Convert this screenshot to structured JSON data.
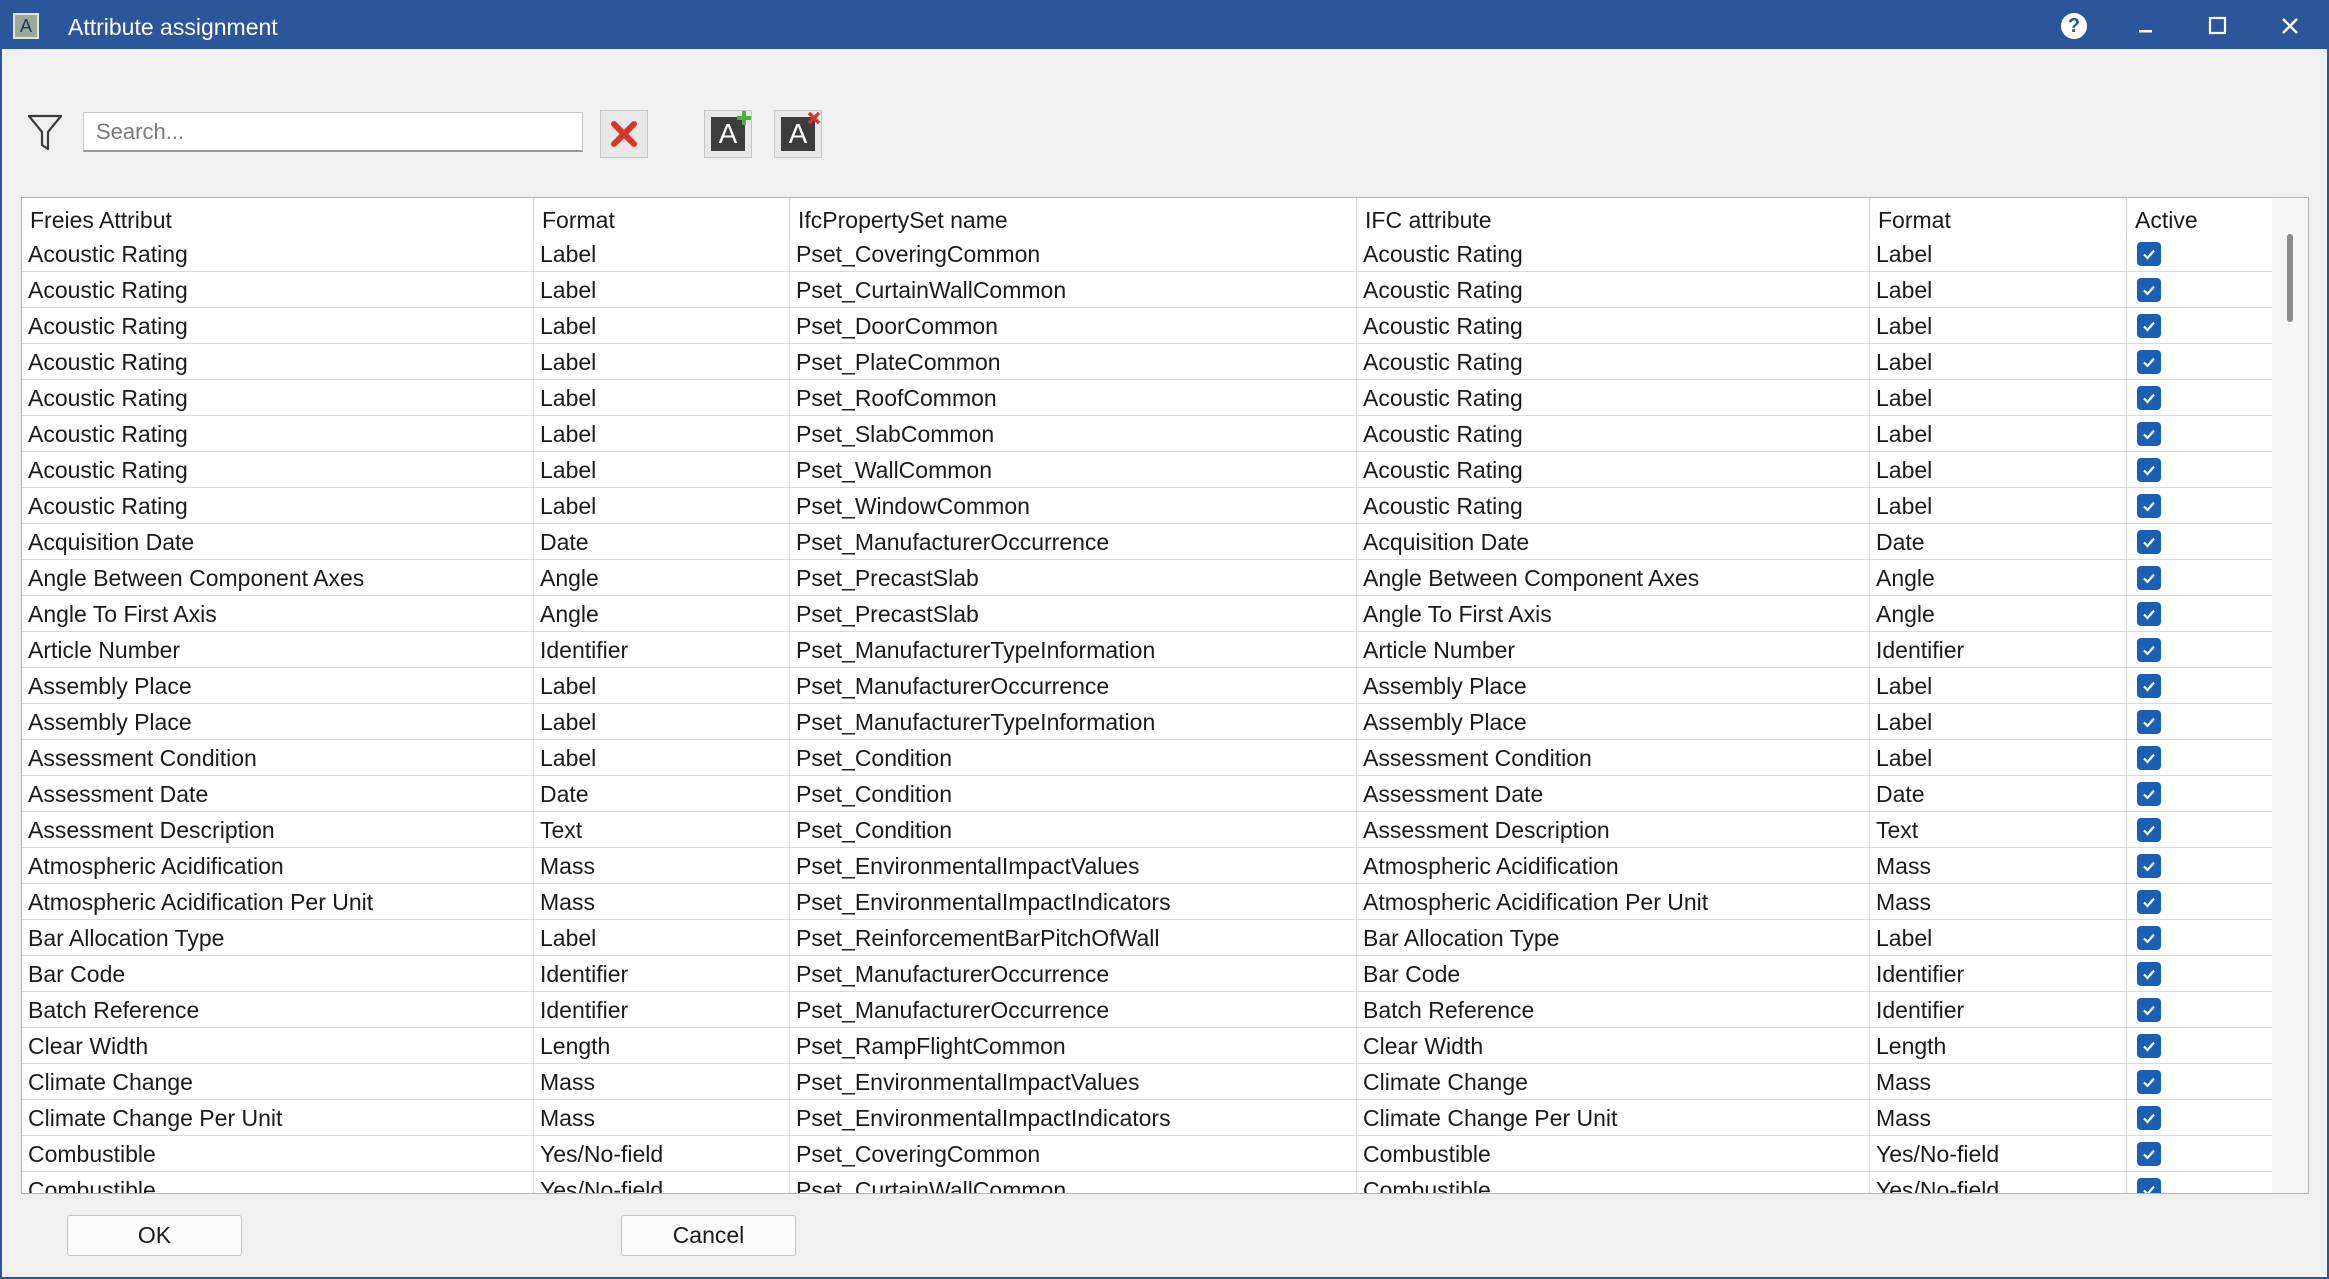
{
  "window": {
    "title": "Attribute assignment",
    "app_icon": "A"
  },
  "toolbar": {
    "search_placeholder": "Search...",
    "search_value": "",
    "add_glyph": "A",
    "delete_glyph": "A"
  },
  "table": {
    "headers": [
      "Freies Attribut",
      "Format",
      "IfcPropertySet name",
      "IFC attribute",
      "Format",
      "Active"
    ],
    "rows": [
      [
        "Acoustic Rating",
        "Label",
        "Pset_CoveringCommon",
        "Acoustic Rating",
        "Label",
        true
      ],
      [
        "Acoustic Rating",
        "Label",
        "Pset_CurtainWallCommon",
        "Acoustic Rating",
        "Label",
        true
      ],
      [
        "Acoustic Rating",
        "Label",
        "Pset_DoorCommon",
        "Acoustic Rating",
        "Label",
        true
      ],
      [
        "Acoustic Rating",
        "Label",
        "Pset_PlateCommon",
        "Acoustic Rating",
        "Label",
        true
      ],
      [
        "Acoustic Rating",
        "Label",
        "Pset_RoofCommon",
        "Acoustic Rating",
        "Label",
        true
      ],
      [
        "Acoustic Rating",
        "Label",
        "Pset_SlabCommon",
        "Acoustic Rating",
        "Label",
        true
      ],
      [
        "Acoustic Rating",
        "Label",
        "Pset_WallCommon",
        "Acoustic Rating",
        "Label",
        true
      ],
      [
        "Acoustic Rating",
        "Label",
        "Pset_WindowCommon",
        "Acoustic Rating",
        "Label",
        true
      ],
      [
        "Acquisition Date",
        "Date",
        "Pset_ManufacturerOccurrence",
        "Acquisition Date",
        "Date",
        true
      ],
      [
        "Angle Between Component Axes",
        "Angle",
        "Pset_PrecastSlab",
        "Angle Between Component Axes",
        "Angle",
        true
      ],
      [
        "Angle To First Axis",
        "Angle",
        "Pset_PrecastSlab",
        "Angle To First Axis",
        "Angle",
        true
      ],
      [
        "Article Number",
        "Identifier",
        "Pset_ManufacturerTypeInformation",
        "Article Number",
        "Identifier",
        true
      ],
      [
        "Assembly Place",
        "Label",
        "Pset_ManufacturerOccurrence",
        "Assembly Place",
        "Label",
        true
      ],
      [
        "Assembly Place",
        "Label",
        "Pset_ManufacturerTypeInformation",
        "Assembly Place",
        "Label",
        true
      ],
      [
        "Assessment Condition",
        "Label",
        "Pset_Condition",
        "Assessment Condition",
        "Label",
        true
      ],
      [
        "Assessment Date",
        "Date",
        "Pset_Condition",
        "Assessment Date",
        "Date",
        true
      ],
      [
        "Assessment Description",
        "Text",
        "Pset_Condition",
        "Assessment Description",
        "Text",
        true
      ],
      [
        "Atmospheric Acidification",
        "Mass",
        "Pset_EnvironmentalImpactValues",
        "Atmospheric Acidification",
        "Mass",
        true
      ],
      [
        "Atmospheric Acidification Per Unit",
        "Mass",
        "Pset_EnvironmentalImpactIndicators",
        "Atmospheric Acidification Per Unit",
        "Mass",
        true
      ],
      [
        "Bar Allocation Type",
        "Label",
        "Pset_ReinforcementBarPitchOfWall",
        "Bar Allocation Type",
        "Label",
        true
      ],
      [
        "Bar Code",
        "Identifier",
        "Pset_ManufacturerOccurrence",
        "Bar Code",
        "Identifier",
        true
      ],
      [
        "Batch Reference",
        "Identifier",
        "Pset_ManufacturerOccurrence",
        "Batch Reference",
        "Identifier",
        true
      ],
      [
        "Clear Width",
        "Length",
        "Pset_RampFlightCommon",
        "Clear Width",
        "Length",
        true
      ],
      [
        "Climate Change",
        "Mass",
        "Pset_EnvironmentalImpactValues",
        "Climate Change",
        "Mass",
        true
      ],
      [
        "Climate Change Per Unit",
        "Mass",
        "Pset_EnvironmentalImpactIndicators",
        "Climate Change Per Unit",
        "Mass",
        true
      ],
      [
        "Combustible",
        "Yes/No-field",
        "Pset_CoveringCommon",
        "Combustible",
        "Yes/No-field",
        true
      ],
      [
        "Combustible",
        "Yes/No-field",
        "Pset_CurtainWallCommon",
        "Combustible",
        "Yes/No-field",
        true
      ]
    ]
  },
  "footer": {
    "ok_label": "OK",
    "cancel_label": "Cancel"
  },
  "colors": {
    "titlebar": "#2b579a",
    "checkbox": "#1a5fb4",
    "clear_x": "#d9362b",
    "add_plus": "#4caf3c"
  },
  "icons": {
    "window": "app-icon",
    "help": "question-icon",
    "minimize": "minimize-icon",
    "maximize": "maximize-icon",
    "close": "close-icon",
    "filter": "filter-funnel-icon",
    "clear": "red-x-icon",
    "add": "add-attribute-icon",
    "delete": "delete-attribute-icon",
    "active": "checkbox-checked-icon"
  }
}
